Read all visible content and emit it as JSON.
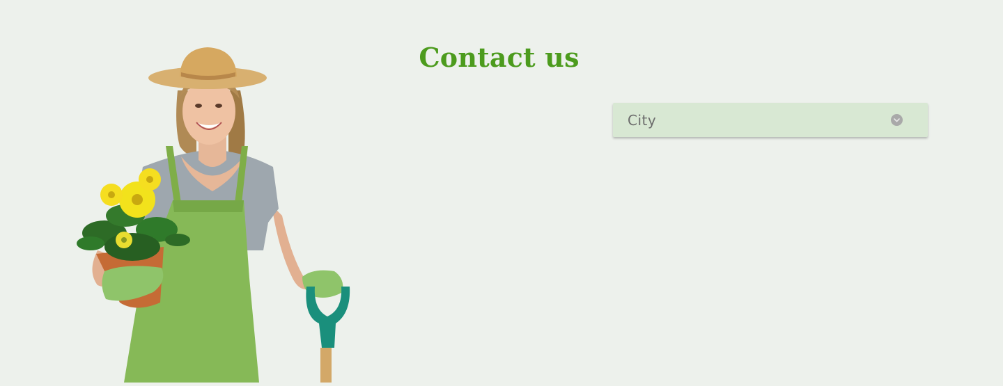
{
  "page": {
    "title": "Contact us"
  },
  "form": {
    "city_select": {
      "selected": "City",
      "icon": "chevron-down-icon"
    }
  },
  "hero": {
    "image": "gardener-with-flowers-and-shovel"
  },
  "colors": {
    "background": "#edf1ec",
    "title": "#4c9b1d",
    "select_bg": "#d8e8d3"
  }
}
